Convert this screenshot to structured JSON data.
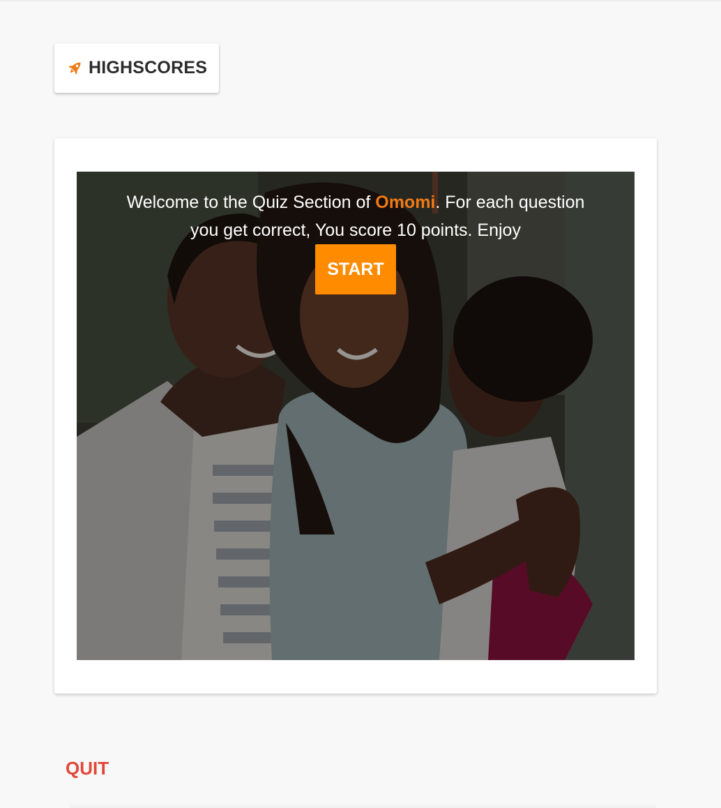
{
  "header": {
    "highscores_label": "HIGHSCORES",
    "highscores_icon": "rocket-icon"
  },
  "quiz": {
    "welcome_prefix": "Welcome to the Quiz Section of ",
    "brand_name": "Omomi",
    "welcome_suffix": ". For each question you get correct, You score 10 points. Enjoy",
    "start_label": "START",
    "hero_image": "family-photo"
  },
  "footer": {
    "quit_label": "QUIT"
  },
  "colors": {
    "accent_orange": "#fe8b00",
    "brand_text_orange": "#ef7a16",
    "quit_red": "#e2463a",
    "background": "#f8f8f8"
  }
}
